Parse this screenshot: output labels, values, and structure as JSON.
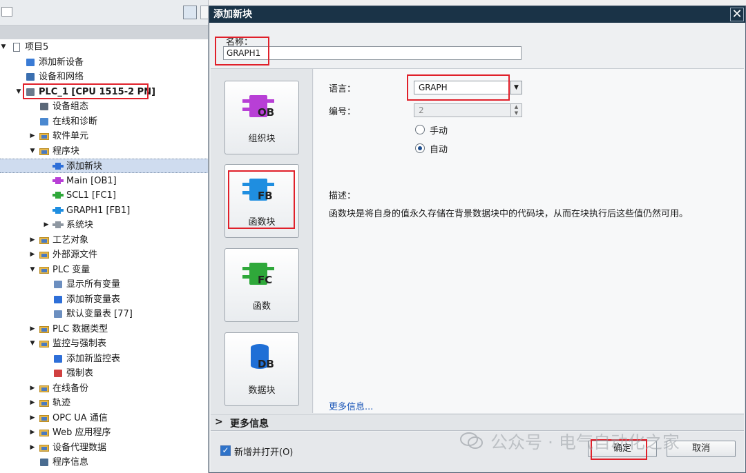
{
  "tree": {
    "items": [
      {
        "label": "项目5",
        "arrow": "▼",
        "indent": 0,
        "icon": "project-icon"
      },
      {
        "label": "添加新设备",
        "arrow": "",
        "indent": 1,
        "icon": "add-device-icon"
      },
      {
        "label": "设备和网络",
        "arrow": "",
        "indent": 1,
        "icon": "network-icon"
      },
      {
        "label": "PLC_1 [CPU 1515-2 PN]",
        "arrow": "▼",
        "indent": 1,
        "icon": "plc-icon",
        "bold": true
      },
      {
        "label": "设备组态",
        "arrow": "",
        "indent": 2,
        "icon": "device-config-icon"
      },
      {
        "label": "在线和诊断",
        "arrow": "",
        "indent": 2,
        "icon": "online-diag-icon"
      },
      {
        "label": "软件单元",
        "arrow": "▶",
        "indent": 2,
        "icon": "folder-icon"
      },
      {
        "label": "程序块",
        "arrow": "▼",
        "indent": 2,
        "icon": "folder-icon"
      },
      {
        "label": "添加新块",
        "arrow": "",
        "indent": 3,
        "icon": "add-block-icon",
        "selected": true
      },
      {
        "label": "Main [OB1]",
        "arrow": "",
        "indent": 3,
        "icon": "ob-block-icon"
      },
      {
        "label": "SCL1 [FC1]",
        "arrow": "",
        "indent": 3,
        "icon": "fc-block-icon"
      },
      {
        "label": "GRAPH1 [FB1]",
        "arrow": "",
        "indent": 3,
        "icon": "fb-block-icon"
      },
      {
        "label": "系统块",
        "arrow": "▶",
        "indent": 3,
        "icon": "system-block-icon"
      },
      {
        "label": "工艺对象",
        "arrow": "▶",
        "indent": 2,
        "icon": "folder-icon"
      },
      {
        "label": "外部源文件",
        "arrow": "▶",
        "indent": 2,
        "icon": "folder-icon"
      },
      {
        "label": "PLC 变量",
        "arrow": "▼",
        "indent": 2,
        "icon": "folder-icon"
      },
      {
        "label": "显示所有变量",
        "arrow": "",
        "indent": 3,
        "icon": "show-vars-icon"
      },
      {
        "label": "添加新变量表",
        "arrow": "",
        "indent": 3,
        "icon": "add-table-icon"
      },
      {
        "label": "默认变量表 [77]",
        "arrow": "",
        "indent": 3,
        "icon": "var-table-icon"
      },
      {
        "label": "PLC 数据类型",
        "arrow": "▶",
        "indent": 2,
        "icon": "folder-icon"
      },
      {
        "label": "监控与强制表",
        "arrow": "▼",
        "indent": 2,
        "icon": "folder-icon"
      },
      {
        "label": "添加新监控表",
        "arrow": "",
        "indent": 3,
        "icon": "add-table-icon"
      },
      {
        "label": "强制表",
        "arrow": "",
        "indent": 3,
        "icon": "force-table-icon"
      },
      {
        "label": "在线备份",
        "arrow": "▶",
        "indent": 2,
        "icon": "folder-icon"
      },
      {
        "label": "轨迹",
        "arrow": "▶",
        "indent": 2,
        "icon": "folder-icon"
      },
      {
        "label": "OPC UA 通信",
        "arrow": "▶",
        "indent": 2,
        "icon": "folder-icon"
      },
      {
        "label": "Web 应用程序",
        "arrow": "▶",
        "indent": 2,
        "icon": "folder-icon"
      },
      {
        "label": "设备代理数据",
        "arrow": "▶",
        "indent": 2,
        "icon": "folder-icon"
      },
      {
        "label": "程序信息",
        "arrow": "",
        "indent": 2,
        "icon": "program-info-icon"
      }
    ]
  },
  "dialog": {
    "title": "添加新块",
    "name_label": "名称：",
    "name_value": "GRAPH1",
    "blocks": [
      {
        "label": "组织块",
        "tag": "OB",
        "color": "#b83fd6",
        "icon": "ob-icon"
      },
      {
        "label": "函数块",
        "tag": "FB",
        "color": "#1f8ee0",
        "icon": "fb-icon"
      },
      {
        "label": "函数",
        "tag": "FC",
        "color": "#2fa83a",
        "icon": "fc-icon"
      },
      {
        "label": "数据块",
        "tag": "DB",
        "color": "#1f6fd6",
        "icon": "db-icon"
      }
    ],
    "language_label": "语言：",
    "language_value": "GRAPH",
    "number_label": "编号：",
    "number_value": "2",
    "radio_manual": "手动",
    "radio_auto": "自动",
    "desc_label": "描述：",
    "desc_text": "函数块是将自身的值永久存储在背景数据块中的代码块，从而在块执行后这些值仍然可用。",
    "more_info_link": "更多信息...",
    "more_info_section": "更多信息",
    "checkbox_label": "新增并打开(O)",
    "ok_label": "确定",
    "cancel_label": "取消"
  },
  "watermark": {
    "text": "公众号 · 电气自动化之家"
  },
  "colors": {
    "titlebar": "#1a3347",
    "highlight": "#e0202a",
    "link": "#1c57b8",
    "selected_row": "#cfdcef"
  }
}
